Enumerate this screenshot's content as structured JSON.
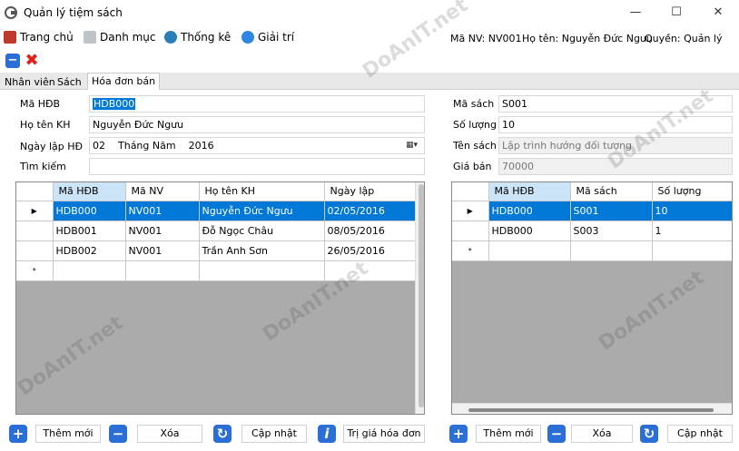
{
  "window": {
    "title": "Quản lý tiệm sách",
    "minimize_glyph": "—",
    "maximize_glyph": "☐",
    "close_glyph": "✕"
  },
  "menu": {
    "items": [
      {
        "label": "Trang chủ",
        "icon": "home-icon",
        "color": "#c0392b"
      },
      {
        "label": "Danh mục",
        "icon": "list-icon",
        "color": "#7f8c8d"
      },
      {
        "label": "Thống kê",
        "icon": "globe-icon",
        "color": "#2980b9"
      },
      {
        "label": "Giải trí",
        "icon": "music-icon",
        "color": "#2e86de"
      }
    ],
    "status": {
      "ma_nv": "Mã NV: NV001",
      "ho_ten": "Họ tên: Nguyễn Đức Ngưu",
      "quyen": "Quyền: Quản lý"
    }
  },
  "tabs": [
    {
      "label": "Nhân viên",
      "active": false
    },
    {
      "label": "Sách",
      "active": false
    },
    {
      "label": "Hóa đơn bán",
      "active": true
    }
  ],
  "invoice_form": {
    "ma_hdb_label": "Mã HĐB",
    "ma_hdb_value": "HDB000",
    "ho_ten_kh_label": "Họ tên KH",
    "ho_ten_kh_value": "Nguyễn Đức Ngưu",
    "ngay_lap_label": "Ngày lập HĐ",
    "ngay_lap_day": "02",
    "ngay_lap_month": "Tháng Năm",
    "ngay_lap_year": "2016",
    "tim_kiem_label": "Tìm kiếm",
    "tim_kiem_value": ""
  },
  "book_form": {
    "ma_sach_label": "Mã sách",
    "ma_sach_value": "S001",
    "so_luong_label": "Số lượng",
    "so_luong_value": "10",
    "ten_sach_label": "Tên sách",
    "ten_sach_value": "Lập trình hướng đối tượng",
    "gia_ban_label": "Giá bán",
    "gia_ban_value": "70000"
  },
  "invoice_grid": {
    "columns": [
      "Mã HĐB",
      "Mã NV",
      "Họ tên KH",
      "Ngày lập"
    ],
    "rows": [
      [
        "HDB000",
        "NV001",
        "Nguyễn Đức Ngưu",
        "02/05/2016"
      ],
      [
        "HDB001",
        "NV001",
        "Đỗ Ngọc Châu",
        "08/05/2016"
      ],
      [
        "HDB002",
        "NV001",
        "Trần Anh Sơn",
        "26/05/2016"
      ]
    ],
    "selected_row": 0,
    "new_row_marker": "*",
    "current_row_marker": "▶"
  },
  "detail_grid": {
    "columns": [
      "Mã HĐB",
      "Mã sách",
      "Số lượng"
    ],
    "rows": [
      [
        "HDB000",
        "S001",
        "10"
      ],
      [
        "HDB000",
        "S003",
        "1"
      ]
    ],
    "selected_row": 0,
    "new_row_marker": "*",
    "current_row_marker": "▶"
  },
  "buttons": {
    "them_moi": "Thêm mới",
    "xoa": "Xóa",
    "cap_nhat": "Cập nhật",
    "tri_gia": "Trị giá hóa đơn",
    "them_moi_2": "Thêm mới",
    "xoa_2": "Xóa",
    "cap_nhat_2": "Cập nhật"
  },
  "watermark": "DoAnIT.net"
}
